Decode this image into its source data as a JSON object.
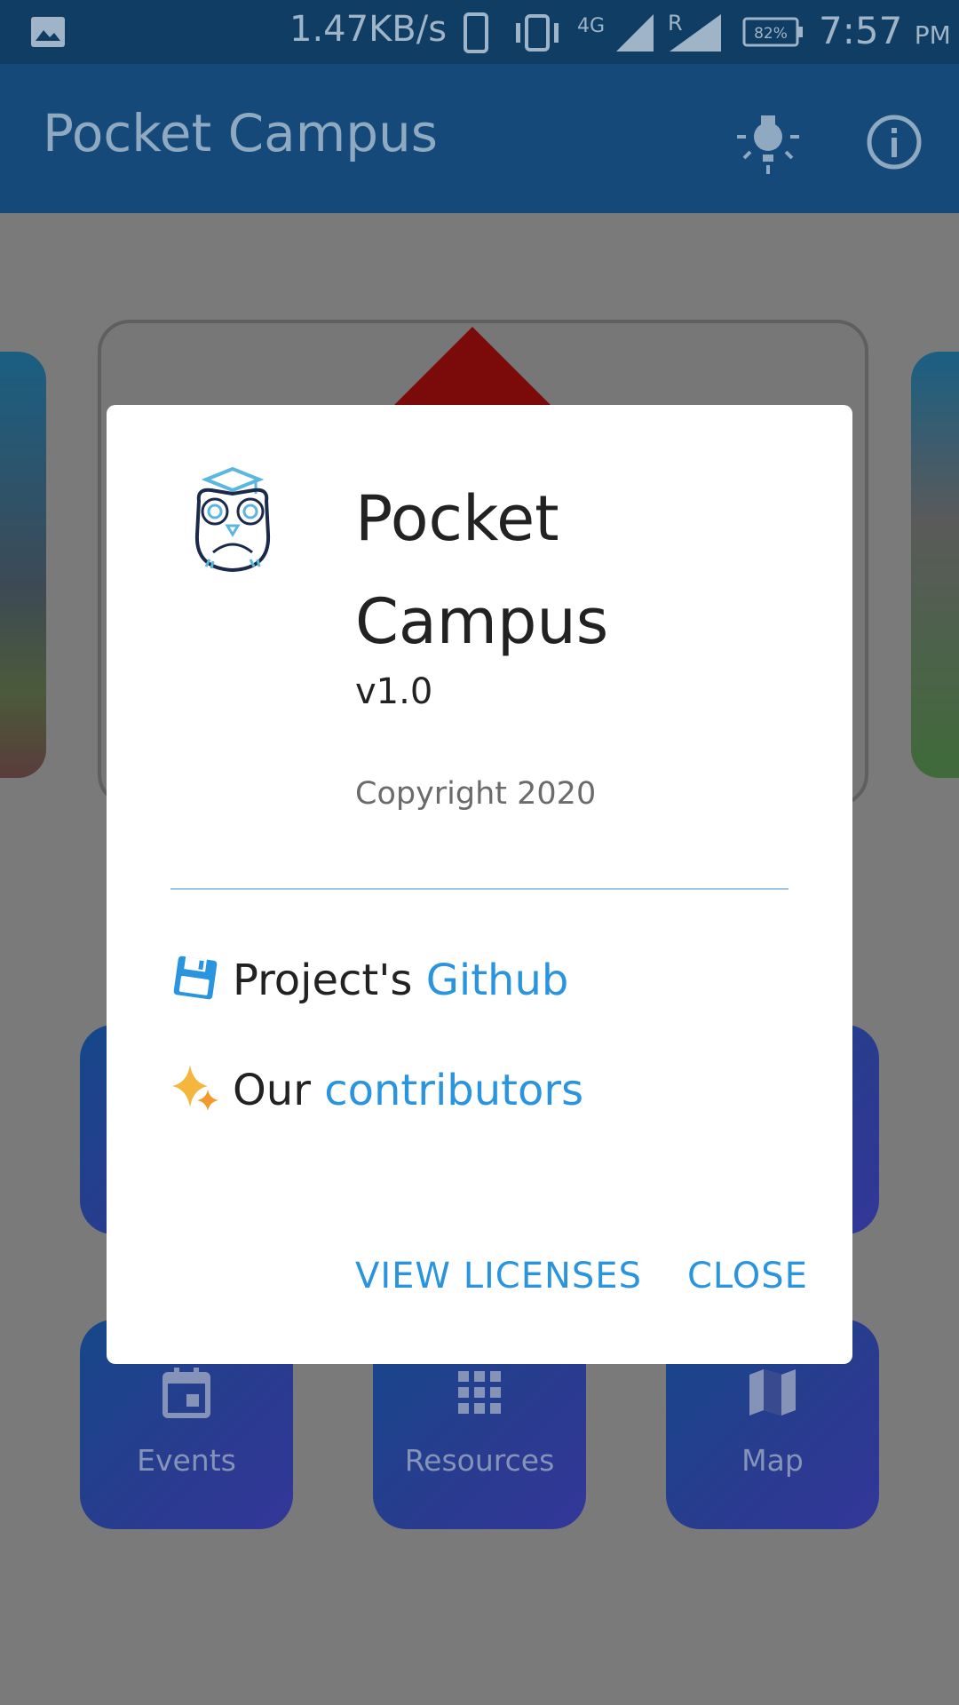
{
  "status_bar": {
    "speed": "1.47KB/s",
    "network": "4G",
    "sim2_label": "R",
    "battery": "82%",
    "time": "7:57",
    "ampm": "PM"
  },
  "app_bar": {
    "title": "Pocket Campus",
    "theme_icon": "lightbulb-icon",
    "info_icon": "info-icon"
  },
  "tiles": [
    {
      "label": "Events",
      "icon": "calendar-icon"
    },
    {
      "label": "Resources",
      "icon": "grid-icon"
    },
    {
      "label": "Map",
      "icon": "map-icon"
    }
  ],
  "dialog": {
    "app_name": "Pocket Campus",
    "version": "v1.0",
    "copyright": "Copyright 2020",
    "github_prefix": "Project's",
    "github_link": "Github",
    "contributors_prefix": "Our",
    "contributors_link": "contributors",
    "view_licenses": "VIEW LICENSES",
    "close": "CLOSE"
  },
  "colors": {
    "app_bar": "#14497a",
    "link": "#2a95de",
    "divider": "#9dc7e6"
  }
}
